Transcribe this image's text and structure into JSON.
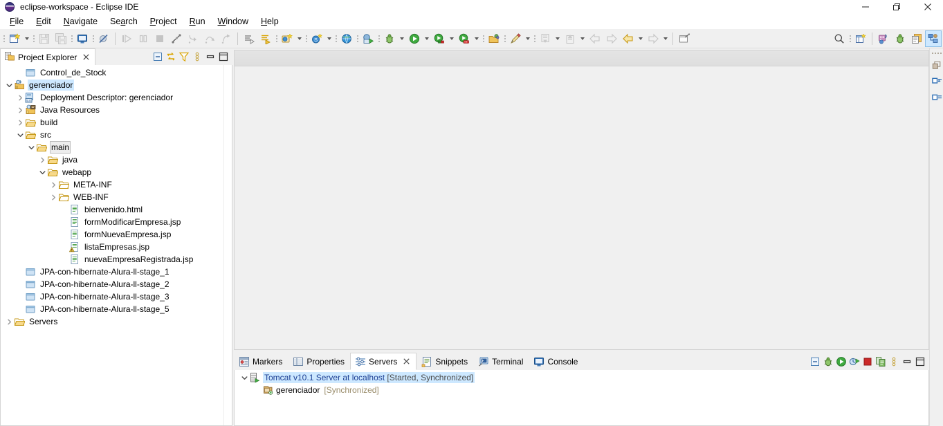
{
  "window": {
    "title": "eclipse-workspace - Eclipse IDE",
    "app_icon": "eclipse-globe-icon",
    "controls": {
      "minimize": "—",
      "restore": "❐",
      "close": "✕"
    }
  },
  "menubar": {
    "items": [
      {
        "label": "File",
        "mnemonic": "F"
      },
      {
        "label": "Edit",
        "mnemonic": "E"
      },
      {
        "label": "Navigate",
        "mnemonic": "N"
      },
      {
        "label": "Search",
        "mnemonic": "a"
      },
      {
        "label": "Project",
        "mnemonic": "P"
      },
      {
        "label": "Run",
        "mnemonic": "R"
      },
      {
        "label": "Window",
        "mnemonic": "W"
      },
      {
        "label": "Help",
        "mnemonic": "H"
      }
    ]
  },
  "toolbar": {
    "buttons": [
      {
        "name": "new-wizard-button",
        "icon": "new-file-icon",
        "enabled": true,
        "has_dropdown": true
      },
      {
        "name": "save-button",
        "icon": "save-icon",
        "enabled": false
      },
      {
        "name": "save-all-button",
        "icon": "save-all-icon",
        "enabled": false
      },
      {
        "name": "new-jsp-file-button",
        "icon": "jsp-file-icon",
        "enabled": true
      },
      {
        "name": "toggle-breakpoint-button",
        "icon": "skip-breakpoints-icon",
        "enabled": true
      },
      {
        "name": "resume-button",
        "icon": "resume-icon",
        "enabled": false
      },
      {
        "name": "suspend-button",
        "icon": "suspend-icon",
        "enabled": false
      },
      {
        "name": "terminate-button",
        "icon": "terminate-stop-icon",
        "enabled": false
      },
      {
        "name": "disconnect-button",
        "icon": "disconnect-icon",
        "enabled": false
      },
      {
        "name": "step-into-button",
        "icon": "step-into-icon",
        "enabled": false
      },
      {
        "name": "step-over-button",
        "icon": "step-over-icon",
        "enabled": false
      },
      {
        "name": "step-return-button",
        "icon": "step-return-icon",
        "enabled": false
      },
      {
        "name": "open-type-button",
        "icon": "open-type-icon",
        "enabled": true
      },
      {
        "name": "open-task-button",
        "icon": "open-task-icon",
        "enabled": true
      },
      {
        "name": "new-java-project-button",
        "icon": "new-java-project-icon",
        "enabled": true,
        "has_dropdown": true
      },
      {
        "name": "new-class-button",
        "icon": "new-class-icon",
        "enabled": true,
        "has_dropdown": true
      },
      {
        "name": "open-web-browser-button",
        "icon": "web-browser-icon",
        "enabled": true
      },
      {
        "name": "run-on-server-button",
        "icon": "run-on-server-icon",
        "enabled": true
      },
      {
        "name": "debug-button",
        "icon": "debug-bug-icon",
        "enabled": true,
        "has_dropdown": true
      },
      {
        "name": "run-button",
        "icon": "run-play-icon",
        "enabled": true,
        "has_dropdown": true
      },
      {
        "name": "coverage-button",
        "icon": "coverage-icon",
        "enabled": true,
        "has_dropdown": true
      },
      {
        "name": "external-tools-button",
        "icon": "external-tools-icon",
        "enabled": true,
        "has_dropdown": true
      },
      {
        "name": "open-perspective-button",
        "icon": "open-perspective-icon",
        "enabled": true
      },
      {
        "name": "annotation-button",
        "icon": "pencil-annotation-icon",
        "enabled": true,
        "has_dropdown": true
      },
      {
        "name": "previous-annotation-button",
        "icon": "prev-annotation-icon",
        "enabled": false,
        "has_dropdown": true
      },
      {
        "name": "next-annotation-button",
        "icon": "next-annotation-icon",
        "enabled": false,
        "has_dropdown": true
      },
      {
        "name": "back-small-button",
        "icon": "back-arrow-icon",
        "enabled": false
      },
      {
        "name": "forward-small-button",
        "icon": "forward-arrow-icon",
        "enabled": false
      },
      {
        "name": "back-button",
        "icon": "back-arrow-yellow-icon",
        "enabled": true,
        "has_dropdown": true
      },
      {
        "name": "forward-button",
        "icon": "forward-arrow-icon",
        "enabled": false,
        "has_dropdown": true
      },
      {
        "name": "pin-editor-button",
        "icon": "pin-editor-icon",
        "enabled": true
      }
    ],
    "right_buttons": [
      {
        "name": "quick-access-search",
        "icon": "search-icon"
      },
      {
        "name": "new-perspective-button",
        "icon": "new-perspective-icon"
      },
      {
        "name": "perspective-java-ee",
        "icon": "java-ee-perspective-icon"
      },
      {
        "name": "perspective-debug",
        "icon": "debug-perspective-icon"
      },
      {
        "name": "perspective-java",
        "icon": "java-perspective-icon"
      },
      {
        "name": "perspective-web",
        "icon": "web-perspective-icon",
        "active": true
      }
    ]
  },
  "project_explorer": {
    "tab_label": "Project Explorer",
    "tab_icon": "project-explorer-icon",
    "close_label": "✕",
    "toolbar": [
      {
        "name": "collapse-all-button",
        "icon": "collapse-all-icon"
      },
      {
        "name": "link-with-editor-button",
        "icon": "link-editor-icon"
      },
      {
        "name": "view-menu-filter-button",
        "icon": "filter-icon"
      },
      {
        "name": "view-menu-button",
        "icon": "view-menu-icon"
      },
      {
        "name": "minimize-view-button",
        "icon": "minimize-icon"
      },
      {
        "name": "maximize-view-button",
        "icon": "maximize-icon"
      }
    ],
    "tree": [
      {
        "label": "Control_de_Stock",
        "indent": 1,
        "twisty": "none",
        "icon": "closed-project-icon",
        "state": "normal"
      },
      {
        "label": "gerenciador",
        "indent": 0,
        "twisty": "down",
        "icon": "dynamic-web-project-icon",
        "state": "selected"
      },
      {
        "label": "Deployment Descriptor: gerenciador",
        "indent": 1,
        "twisty": "right",
        "icon": "deployment-descriptor-icon",
        "state": "normal"
      },
      {
        "label": "Java Resources",
        "indent": 1,
        "twisty": "right",
        "icon": "java-resources-icon",
        "state": "normal"
      },
      {
        "label": "build",
        "indent": 1,
        "twisty": "right",
        "icon": "folder-icon",
        "state": "normal"
      },
      {
        "label": "src",
        "indent": 1,
        "twisty": "down",
        "icon": "folder-icon",
        "state": "normal"
      },
      {
        "label": "main",
        "indent": 2,
        "twisty": "down",
        "icon": "folder-icon",
        "state": "outlined"
      },
      {
        "label": "java",
        "indent": 3,
        "twisty": "right",
        "icon": "folder-icon",
        "state": "normal"
      },
      {
        "label": "webapp",
        "indent": 3,
        "twisty": "down",
        "icon": "folder-icon",
        "state": "normal"
      },
      {
        "label": "META-INF",
        "indent": 4,
        "twisty": "right",
        "icon": "folder-plain-icon",
        "state": "normal"
      },
      {
        "label": "WEB-INF",
        "indent": 4,
        "twisty": "right",
        "icon": "folder-plain-icon",
        "state": "normal"
      },
      {
        "label": "bienvenido.html",
        "indent": 5,
        "twisty": "none",
        "icon": "html-file-icon",
        "state": "normal"
      },
      {
        "label": "formModificarEmpresa.jsp",
        "indent": 5,
        "twisty": "none",
        "icon": "jsp-file-icon",
        "state": "normal"
      },
      {
        "label": "formNuevaEmpresa.jsp",
        "indent": 5,
        "twisty": "none",
        "icon": "jsp-file-icon",
        "state": "normal"
      },
      {
        "label": "listaEmpresas.jsp",
        "indent": 5,
        "twisty": "none",
        "icon": "jsp-file-warning-icon",
        "state": "normal"
      },
      {
        "label": "nuevaEmpresaRegistrada.jsp",
        "indent": 5,
        "twisty": "none",
        "icon": "jsp-file-icon",
        "state": "normal"
      },
      {
        "label": "JPA-con-hibernate-Alura-ll-stage_1",
        "indent": 1,
        "twisty": "none",
        "icon": "closed-project-icon",
        "state": "normal"
      },
      {
        "label": "JPA-con-hibernate-Alura-ll-stage_2",
        "indent": 1,
        "twisty": "none",
        "icon": "closed-project-icon",
        "state": "normal"
      },
      {
        "label": "JPA-con-hibernate-Alura-ll-stage_3",
        "indent": 1,
        "twisty": "none",
        "icon": "closed-project-icon",
        "state": "normal"
      },
      {
        "label": "JPA-con-hibernate-Alura-ll-stage_5",
        "indent": 1,
        "twisty": "none",
        "icon": "closed-project-icon",
        "state": "normal"
      },
      {
        "label": "Servers",
        "indent": 0,
        "twisty": "right",
        "icon": "folder-icon",
        "state": "normal"
      }
    ]
  },
  "editor": {
    "empty": true
  },
  "bottom_panel": {
    "tabs": [
      {
        "label": "Markers",
        "icon": "markers-icon",
        "active": false
      },
      {
        "label": "Properties",
        "icon": "properties-icon",
        "active": false
      },
      {
        "label": "Servers",
        "icon": "servers-icon",
        "active": true,
        "close_label": "✕"
      },
      {
        "label": "Snippets",
        "icon": "snippets-icon",
        "active": false
      },
      {
        "label": "Terminal",
        "icon": "terminal-icon",
        "active": false
      },
      {
        "label": "Console",
        "icon": "console-icon",
        "active": false
      }
    ],
    "toolbar": [
      {
        "name": "collapse-all-servers-button",
        "icon": "collapse-all-icon"
      },
      {
        "name": "debug-server-button",
        "icon": "debug-bug-icon"
      },
      {
        "name": "start-server-button",
        "icon": "run-play-icon"
      },
      {
        "name": "profile-server-button",
        "icon": "profile-icon"
      },
      {
        "name": "stop-server-button",
        "icon": "terminate-stop-icon"
      },
      {
        "name": "publish-server-button",
        "icon": "publish-icon"
      },
      {
        "name": "view-menu-button",
        "icon": "view-menu-icon"
      },
      {
        "name": "minimize-view-button",
        "icon": "minimize-icon"
      },
      {
        "name": "maximize-view-button",
        "icon": "maximize-icon"
      }
    ],
    "servers": [
      {
        "name": "Tomcat v10.1 Server at localhost",
        "status": "[Started, Synchronized]",
        "icon": "tomcat-server-icon",
        "twisty": "down",
        "selected": true,
        "modules": [
          {
            "name": "gerenciador",
            "status": "[Synchronized]",
            "icon": "web-module-icon"
          }
        ]
      }
    ]
  },
  "rail": {
    "buttons": [
      {
        "name": "restore-view-button",
        "icon": "restore-icon"
      },
      {
        "name": "outline-view-button",
        "icon": "outline-view-icon"
      },
      {
        "name": "task-list-view-button",
        "icon": "task-list-icon"
      }
    ]
  },
  "colors": {
    "selection": "#cde8ff",
    "toolbar_bg": "#f0f0f0",
    "panel_bg": "#ffffff",
    "border": "#d4d4d4",
    "server_name": "#1c3f94",
    "module_status": "#9a8d6b",
    "folder": "#e8a33d",
    "accent_green": "#2f9e2f"
  }
}
